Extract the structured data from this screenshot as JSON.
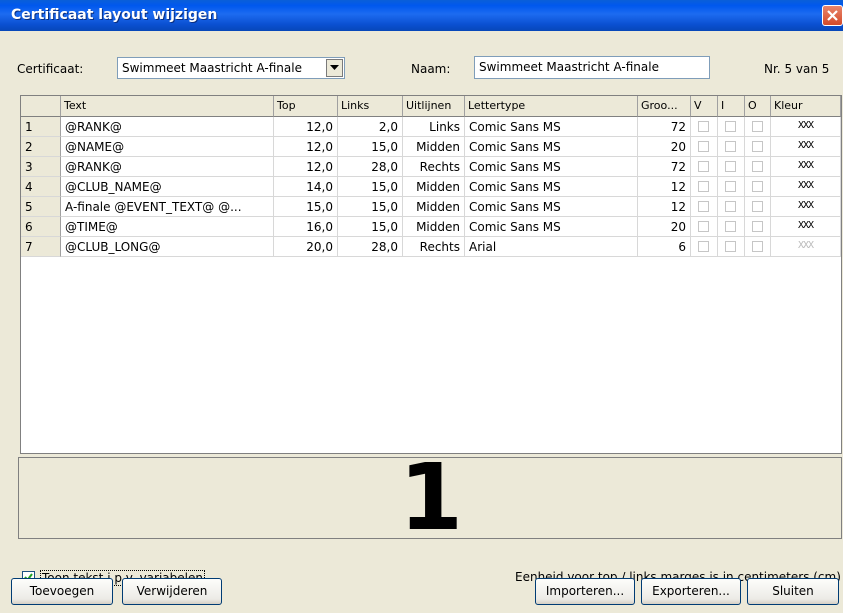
{
  "window": {
    "title": "Certificaat layout wijzigen"
  },
  "top": {
    "certificaat_label": "Certificaat:",
    "certificaat_value": "Swimmeet Maastricht A-finale",
    "naam_label": "Naam:",
    "naam_value": "Swimmeet Maastricht A-finale",
    "record_count": "Nr. 5 van 5"
  },
  "grid": {
    "columns": [
      "Text",
      "Top",
      "Links",
      "Uitlijnen",
      "Lettertype",
      "Groo...",
      "V",
      "I",
      "O",
      "Kleur"
    ],
    "rows": [
      {
        "num": "1",
        "text": "@RANK@",
        "top": "12,0",
        "links": "2,0",
        "uitlijnen": "Links",
        "lettertype": "Comic Sans MS",
        "groot": "72",
        "kleur": "XXX"
      },
      {
        "num": "2",
        "text": "@NAME@",
        "top": "12,0",
        "links": "15,0",
        "uitlijnen": "Midden",
        "lettertype": "Comic Sans MS",
        "groot": "20",
        "kleur": "XXX"
      },
      {
        "num": "3",
        "text": "@RANK@",
        "top": "12,0",
        "links": "28,0",
        "uitlijnen": "Rechts",
        "lettertype": "Comic Sans MS",
        "groot": "72",
        "kleur": "XXX"
      },
      {
        "num": "4",
        "text": "@CLUB_NAME@",
        "top": "14,0",
        "links": "15,0",
        "uitlijnen": "Midden",
        "lettertype": "Comic Sans MS",
        "groot": "12",
        "kleur": "XXX"
      },
      {
        "num": "5",
        "text": "A-finale @EVENT_TEXT@ @...",
        "top": "15,0",
        "links": "15,0",
        "uitlijnen": "Midden",
        "lettertype": "Comic Sans MS",
        "groot": "12",
        "kleur": "XXX"
      },
      {
        "num": "6",
        "text": "@TIME@",
        "top": "16,0",
        "links": "15,0",
        "uitlijnen": "Midden",
        "lettertype": "Comic Sans MS",
        "groot": "20",
        "kleur": "XXX"
      },
      {
        "num": "7",
        "text": "@CLUB_LONG@",
        "top": "20,0",
        "links": "28,0",
        "uitlijnen": "Rechts",
        "lettertype": "Arial",
        "groot": "6",
        "kleur": "XXX"
      }
    ]
  },
  "preview": {
    "text": "1"
  },
  "bottom": {
    "checkbox_label": "Toon tekst i.p.v. variabelen",
    "unit_note": "Eenheid voor top / links marges is in centimeters (cm)",
    "buttons": {
      "toevoegen": "Toevoegen",
      "verwijderen": "Verwijderen",
      "importeren": "Importeren...",
      "exporteren": "Exporteren...",
      "sluiten": "Sluiten"
    }
  },
  "colors": {
    "titlebar": "#0058ee",
    "window_bg": "#ece9d8",
    "kleur_gray": "#bbbbbb"
  }
}
